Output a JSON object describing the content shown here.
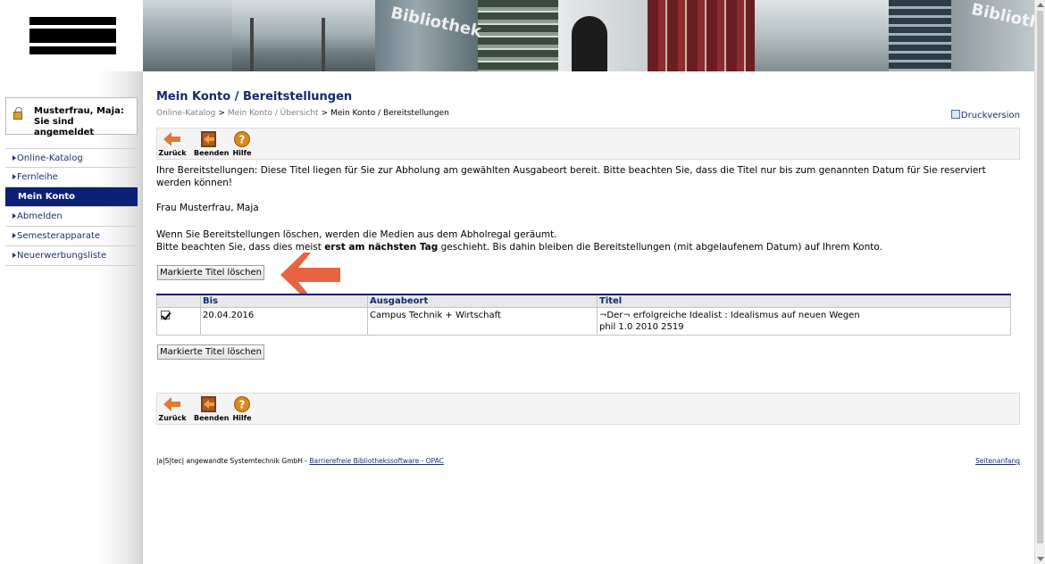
{
  "banner": {
    "text_left": "Bibliothek",
    "text_right": "Bibliothek"
  },
  "login": {
    "status": "Musterfrau, Maja: Sie sind angemeldet"
  },
  "sidebar": {
    "items": [
      {
        "label": "Online-Katalog",
        "active": false
      },
      {
        "label": "Fernleihe",
        "active": false
      },
      {
        "label": "Mein Konto",
        "active": true
      },
      {
        "label": "Abmelden",
        "active": false
      },
      {
        "label": "Semesterapparate",
        "active": false
      },
      {
        "label": "Neuerwerbungsliste",
        "active": false
      }
    ]
  },
  "page": {
    "title": "Mein Konto / Bereitstellungen",
    "print_label": "Druckversion",
    "breadcrumb": {
      "item1": "Online-Katalog",
      "item2": "Mein Konto / Übersicht",
      "current": "Mein Konto / Bereitstellungen",
      "separator": ">"
    }
  },
  "toolbar": {
    "back_label": "Zurück",
    "exit_label": "Beenden",
    "help_label": "Hilfe"
  },
  "content": {
    "intro": "Ihre Bereitstellungen: Diese Titel liegen für Sie zur Abholung am gewählten Ausgabeort bereit. Bitte beachten Sie, dass die Titel nur bis zum genannten Datum für Sie reserviert werden können!",
    "user_name": "Frau Musterfrau, Maja",
    "note_line1": "Wenn Sie Bereitstellungen löschen, werden die Medien aus dem Abholregal geräumt.",
    "note_line2_pre": "Bitte beachten Sie, dass dies meist ",
    "note_line2_bold": "erst am nächsten Tag",
    "note_line2_post": " geschieht. Bis dahin bleiben die Bereitstellungen (mit abgelaufenem Datum) auf Ihrem Konto.",
    "delete_button": "Markierte Titel löschen"
  },
  "table": {
    "headers": [
      "",
      "Bis",
      "Ausgabeort",
      "Titel"
    ],
    "rows": [
      {
        "checked": true,
        "bis": "20.04.2016",
        "ausgabeort": "Campus Technik + Wirtschaft",
        "titel_line1": "¬Der¬ erfolgreiche Idealist : Idealismus auf neuen Wegen",
        "titel_line2": "phil 1.0 2010 2519"
      }
    ]
  },
  "footer": {
    "company": "|a|S|tec| angewandte Systemtechnik GmbH -",
    "link": "Barrierefreie Bibliothekssoftware - OPAC",
    "top_link": "Seitenanfang"
  },
  "colors": {
    "nav_active_bg": "#0c2075",
    "title_color": "#132a66",
    "arrow_color": "#e8633f",
    "table_top_border": "#0d1f6a"
  }
}
